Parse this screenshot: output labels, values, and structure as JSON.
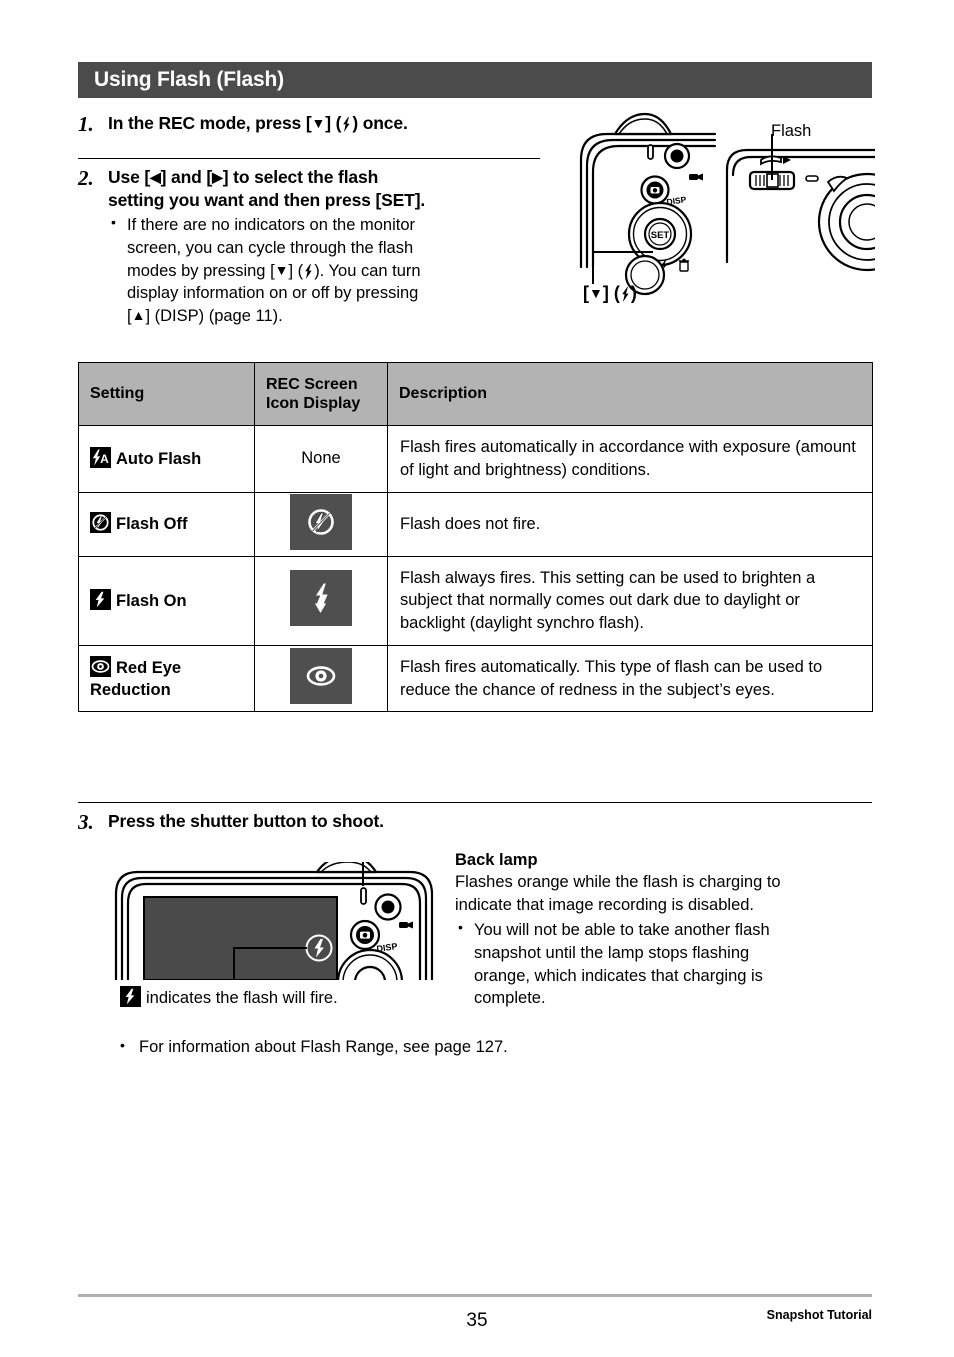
{
  "section": {
    "title": "Using Flash (Flash)"
  },
  "steps": [
    {
      "number": "1.",
      "head_pre": "In the REC mode, press [",
      "head_mid": "] (",
      "head_post": ") once."
    },
    {
      "number": "2.",
      "head_line1_a": "Use [",
      "head_line1_b": "] and [",
      "head_line1_c": "] to select the flash",
      "head_line2": "setting you want and then press [SET].",
      "bullet_a": "If there are no indicators on the monitor",
      "bullet_b": "screen, you can cycle through the flash",
      "bullet_c1": "modes by pressing [",
      "bullet_c2": "] (",
      "bullet_c3": "). You can turn",
      "bullet_d": "display information on or off by pressing",
      "bullet_e1": "[",
      "bullet_e2": "] (DISP) (page 11)."
    },
    {
      "number": "3.",
      "head": "Press the shutter button to shoot."
    }
  ],
  "figures": {
    "top": {
      "flash_label": "Flash",
      "key_callout_pre": "[",
      "key_callout_mid": "] (",
      "key_callout_post": ")",
      "disp_label": "DISP",
      "set_label": "SET"
    },
    "bottom": {
      "disp_label": "DISP",
      "caption_text": "indicates the flash will fire."
    }
  },
  "table": {
    "headers": [
      "Setting",
      "REC Screen\nIcon Display",
      "Description"
    ],
    "header_setting": "Setting",
    "header_icon_line1": "REC Screen",
    "header_icon_line2": "Icon Display",
    "header_description": "Description",
    "rows": [
      {
        "icon": "auto-flash-badge-icon",
        "setting": "Auto Flash",
        "rec_icon": "none",
        "rec_icon_text": "None",
        "description": "Flash fires automatically in accordance with exposure (amount of light and brightness) conditions."
      },
      {
        "icon": "flash-off-badge-icon",
        "setting": "Flash Off",
        "rec_icon": "flash-off-tile-icon",
        "rec_icon_text": "",
        "description": "Flash does not fire."
      },
      {
        "icon": "flash-on-badge-icon",
        "setting": "Flash On",
        "rec_icon": "flash-on-tile-icon",
        "rec_icon_text": "",
        "description": "Flash always fires. This setting can be used to brighten a subject that normally comes out dark due to daylight or backlight (daylight synchro flash)."
      },
      {
        "icon": "red-eye-badge-icon",
        "setting": "Red Eye Reduction",
        "rec_icon": "red-eye-tile-icon",
        "rec_icon_text": "",
        "description": "Flash fires automatically. This type of flash can be used to reduce the chance of redness in the subject’s eyes."
      }
    ]
  },
  "back_lamp": {
    "title": "Back lamp",
    "line1": "Flashes orange while the flash is charging to",
    "line2": "indicate that image recording is disabled.",
    "bullet1": "You will not be able to take another flash",
    "bullet2": "snapshot until the lamp stops flashing",
    "bullet3": "orange, which indicates that charging is",
    "bullet4": "complete."
  },
  "final_note": "For information about Flash Range, see page 127.",
  "footer": {
    "page_number": "35",
    "section_label": "Snapshot Tutorial"
  },
  "colors": {
    "section_bar": "#4b4b4b",
    "table_header": "#b3b3b3",
    "tile_bg": "#4f4f4f",
    "footer_rule": "#b0b0b0"
  }
}
